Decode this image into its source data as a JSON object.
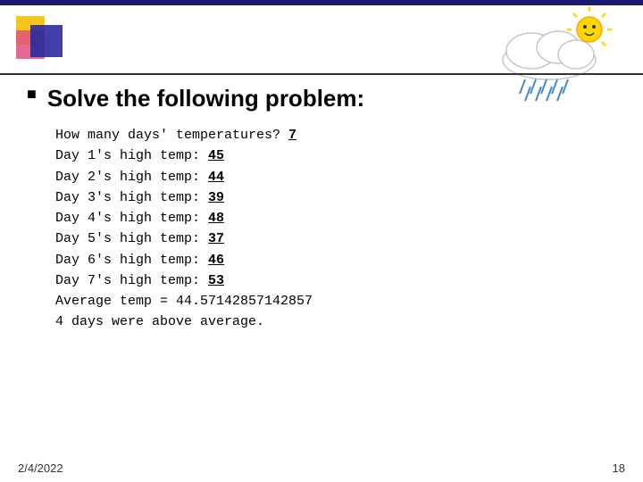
{
  "top_bar": {},
  "heading": {
    "bullet": "■",
    "title": "Solve the following problem:"
  },
  "content": {
    "line0": "How many days' temperatures? ",
    "line0_val": "7",
    "days": [
      {
        "label": "Day 1's high temp: ",
        "val": "45"
      },
      {
        "label": "Day 2's high temp: ",
        "val": "44"
      },
      {
        "label": "Day 3's high temp: ",
        "val": "39"
      },
      {
        "label": "Day 4's high temp: ",
        "val": "48"
      },
      {
        "label": "Day 5's high temp: ",
        "val": "37"
      },
      {
        "label": "Day 6's high temp: ",
        "val": "46"
      },
      {
        "label": "Day 7's high temp: ",
        "val": "53"
      }
    ],
    "average_line": "Average temp = 44.57142857142857",
    "above_line": "4 days were above average."
  },
  "footer": {
    "date": "2/4/2022",
    "page": "18"
  }
}
